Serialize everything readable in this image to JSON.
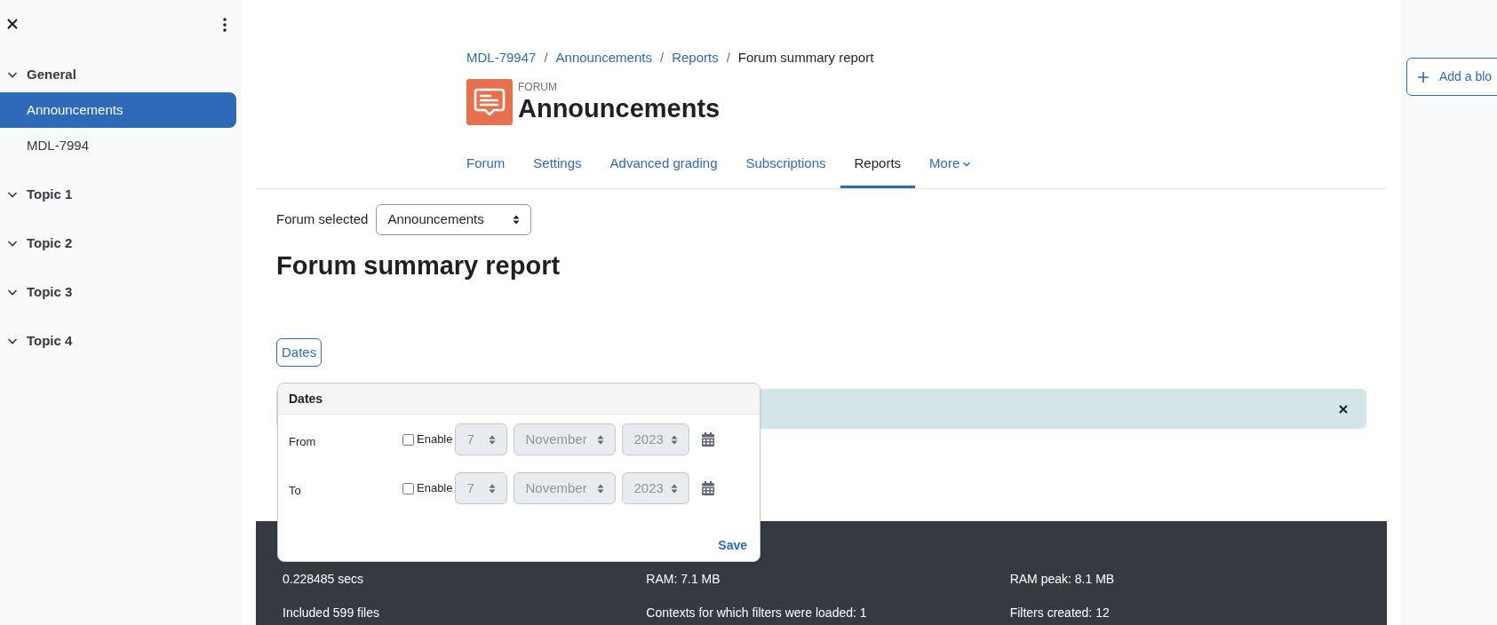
{
  "sidebar": {
    "sections": [
      {
        "label": "General",
        "expanded": true,
        "children": [
          {
            "label": "Announcements",
            "selected": true
          },
          {
            "label": "MDL-7994",
            "selected": false
          }
        ]
      },
      {
        "label": "Topic 1",
        "expanded": true
      },
      {
        "label": "Topic 2",
        "expanded": true
      },
      {
        "label": "Topic 3",
        "expanded": true
      },
      {
        "label": "Topic 4",
        "expanded": true
      }
    ]
  },
  "breadcrumb": [
    {
      "label": "MDL-79947",
      "kind": "link"
    },
    {
      "label": "/",
      "kind": "separator"
    },
    {
      "label": "Announcements",
      "kind": "link"
    },
    {
      "label": "/",
      "kind": "separator"
    },
    {
      "label": "Reports",
      "kind": "link"
    },
    {
      "label": "/",
      "kind": "separator"
    },
    {
      "label": "Forum summary report",
      "kind": "current"
    }
  ],
  "activity": {
    "type_label": "FORUM",
    "title": "Announcements"
  },
  "tabs": [
    {
      "label": "Forum",
      "selected": false,
      "kind": "link"
    },
    {
      "label": "Settings",
      "selected": false,
      "kind": "link"
    },
    {
      "label": "Advanced grading",
      "selected": false,
      "kind": "link"
    },
    {
      "label": "Subscriptions",
      "selected": false,
      "kind": "link"
    },
    {
      "label": "Reports",
      "selected": true,
      "kind": "link"
    },
    {
      "label": "More",
      "selected": false,
      "kind": "menu"
    }
  ],
  "forum_select": {
    "label": "Forum selected",
    "value": "Announcements"
  },
  "heading": "Forum summary report",
  "filter_button": "Dates",
  "dates_popover": {
    "title": "Dates",
    "save": "Save",
    "rows": [
      {
        "label": "From",
        "enable_label": "Enable",
        "checked": false,
        "day": "7",
        "month": "November",
        "year": "2023"
      },
      {
        "label": "To",
        "enable_label": "Enable",
        "checked": false,
        "day": "7",
        "month": "November",
        "year": "2023"
      }
    ]
  },
  "footer": {
    "stats": [
      "0.228485 secs",
      "RAM: 7.1 MB",
      "RAM peak: 8.1 MB",
      "Included 599 files",
      "Contexts for which filters were loaded: 1",
      "Filters created: 12"
    ]
  },
  "block_drawer": {
    "add_block": "Add a blo"
  }
}
